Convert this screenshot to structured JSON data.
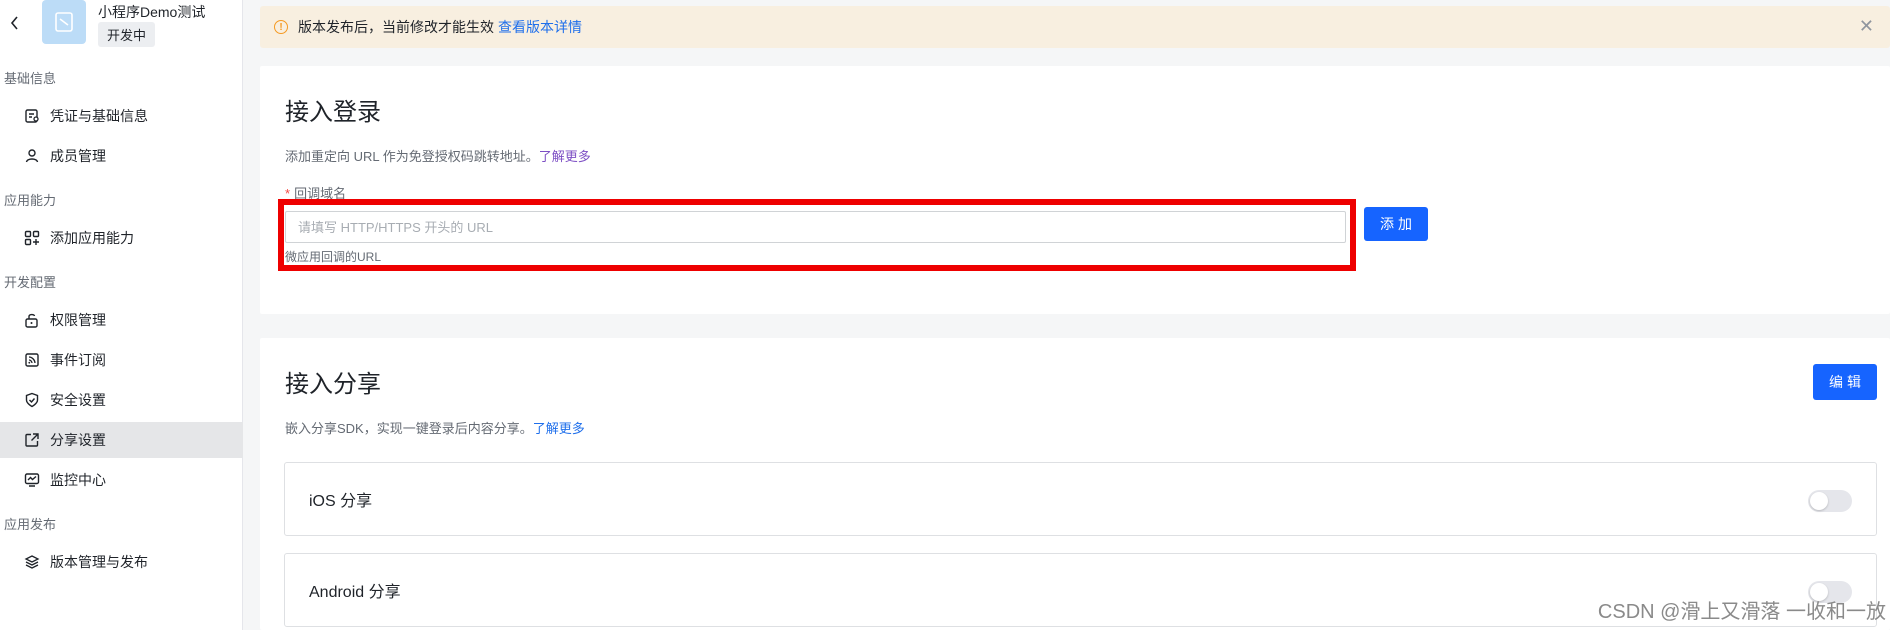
{
  "app": {
    "name": "小程序Demo测试",
    "status": "开发中"
  },
  "sidebar": {
    "groups": [
      {
        "title": "基础信息",
        "items": [
          {
            "label": "凭证与基础信息",
            "icon": "credential-icon"
          },
          {
            "label": "成员管理",
            "icon": "user-icon"
          }
        ]
      },
      {
        "title": "应用能力",
        "items": [
          {
            "label": "添加应用能力",
            "icon": "apps-icon"
          }
        ]
      },
      {
        "title": "开发配置",
        "items": [
          {
            "label": "权限管理",
            "icon": "unlock-icon"
          },
          {
            "label": "事件订阅",
            "icon": "event-icon"
          },
          {
            "label": "安全设置",
            "icon": "shield-icon"
          },
          {
            "label": "分享设置",
            "icon": "share-icon",
            "active": true
          },
          {
            "label": "监控中心",
            "icon": "monitor-icon"
          }
        ]
      },
      {
        "title": "应用发布",
        "items": [
          {
            "label": "版本管理与发布",
            "icon": "layers-icon"
          }
        ]
      }
    ]
  },
  "banner": {
    "text": "版本发布后，当前修改才能生效",
    "link": "查看版本详情"
  },
  "login_card": {
    "title": "接入登录",
    "desc": "添加重定向 URL 作为免登授权码跳转地址。",
    "desc_link": "了解更多",
    "field_label": "回调域名",
    "field_required_mark": "*",
    "field_placeholder": "请填写 HTTP/HTTPS 开头的 URL",
    "field_value": "",
    "field_hint": "微应用回调的URL",
    "add_button": "添加"
  },
  "share_card": {
    "title": "接入分享",
    "desc": "嵌入分享SDK，实现一键登录后内容分享。",
    "desc_link": "了解更多",
    "edit_button": "编辑",
    "rows": [
      {
        "label": "iOS 分享",
        "enabled": false
      },
      {
        "label": "Android 分享",
        "enabled": false
      }
    ]
  },
  "watermark": "CSDN @滑上又滑落 一收和一放",
  "colors": {
    "primary": "#1664ff",
    "banner_bg": "#f8efe0",
    "warning": "#f59a23",
    "highlight_box": "#ee0000",
    "link_purple": "#7d4fc4"
  }
}
